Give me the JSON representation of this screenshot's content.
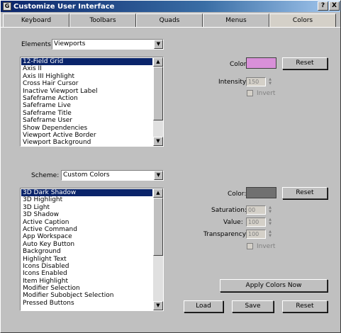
{
  "window": {
    "title": "Customize User Interface",
    "icon_letter": "G",
    "help_label": "?",
    "close_label": "X"
  },
  "tabs": [
    "Keyboard",
    "Toolbars",
    "Quads",
    "Menus",
    "Colors"
  ],
  "active_tab": "Colors",
  "elements": {
    "label": "Elements:",
    "value": "Viewports",
    "items": [
      "12-Field Grid",
      "Axis II",
      "Axis III Highlight",
      "Cross Hair Cursor",
      "Inactive Viewport Label",
      "Safeframe Action",
      "Safeframe Live",
      "Safeframe Title",
      "Safeframe User",
      "Show Dependencies",
      "Viewport Active Border",
      "Viewport Background"
    ],
    "selected_index": 0
  },
  "viewport_color": {
    "color_label": "Color:",
    "color": "#d890d8",
    "reset_label": "Reset",
    "intensity_label": "Intensity:",
    "intensity_value": "150",
    "invert_label": "Invert"
  },
  "scheme": {
    "label": "Scheme:",
    "value": "Custom Colors",
    "items": [
      "3D Dark Shadow",
      "3D Highlight",
      "3D Light",
      "3D Shadow",
      "Active Caption",
      "Active Command",
      "App Workspace",
      "Auto Key Button",
      "Background",
      "Highlight Text",
      "Icons Disabled",
      "Icons Enabled",
      "Item Highlight",
      "Modifier Selection",
      "Modifier Subobject Selection",
      "Pressed Buttons"
    ],
    "selected_index": 0
  },
  "scheme_color": {
    "color_label": "Color:",
    "color": "#707070",
    "reset_label": "Reset",
    "saturation_label": "Saturation:",
    "saturation_value": "00",
    "value_label": "Value:",
    "value_value": "100",
    "transparency_label": "Transparency:",
    "transparency_value": "100",
    "invert_label": "Invert"
  },
  "buttons": {
    "apply_label": "Apply Colors Now",
    "load_label": "Load",
    "save_label": "Save",
    "reset_label": "Reset"
  }
}
